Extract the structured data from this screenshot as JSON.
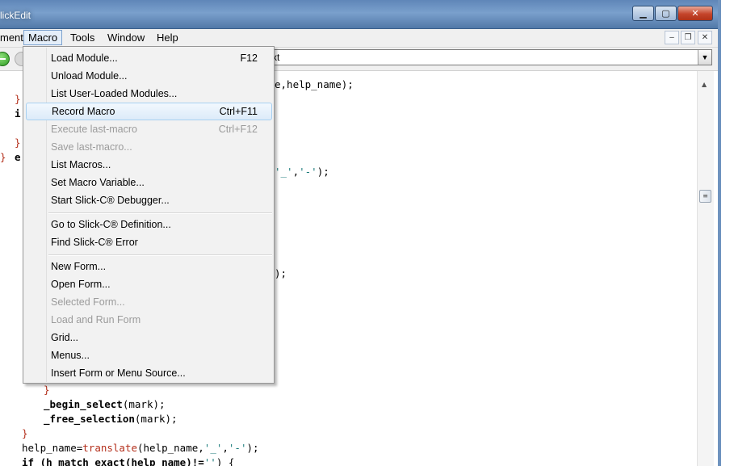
{
  "window": {
    "title": "lickEdit",
    "minimize_icon": "▁",
    "maximize_icon": "▢",
    "close_icon": "✕"
  },
  "menubar": {
    "items": [
      "ment",
      "Macro",
      "Tools",
      "Window",
      "Help"
    ],
    "mdi_minimize": "–",
    "mdi_restore": "❐",
    "mdi_close": "✕"
  },
  "toolbar": {
    "combo_value": "xt",
    "combo_arrow": "▼"
  },
  "editor": {
    "lines": [
      {
        "indent": "",
        "segs": [
          [
            "",
            "e,help_name);"
          ]
        ]
      },
      {
        "indent": "  ",
        "segs": [
          [
            "red",
            "}"
          ]
        ]
      },
      {
        "indent": "  ",
        "segs": [
          [
            "kw",
            "i"
          ]
        ]
      },
      {
        "indent": "  ",
        "segs": [
          [
            "",
            ""
          ]
        ]
      },
      {
        "indent": "  ",
        "segs": [
          [
            "red",
            "}"
          ]
        ]
      },
      {
        "indent": "",
        "segs": [
          [
            "red",
            "}"
          ],
          [
            "",
            " "
          ],
          [
            "kw",
            "e"
          ]
        ]
      }
    ],
    "frag_help": "e,help_name);",
    "frag_replace_a": "'_'",
    "frag_replace_sep": ",",
    "frag_replace_b": "'-'",
    "frag_replace_end": ");",
    "frag_close": ");",
    "bottom_brace": "}",
    "begin_select": "_begin_select",
    "begin_select_args": "(mark);",
    "free_selection": "_free_selection",
    "free_selection_args": "(mark);",
    "close_brace": "}",
    "help_name_assign": "help_name=",
    "translate_fn": "translate",
    "translate_args_a": "(help_name,",
    "translate_str1": "'_'",
    "translate_comma": ",",
    "translate_str2": "'-'",
    "translate_end": ");",
    "if_kw": "if",
    "if_rest": " (h_match_exact(help_name)!=",
    "if_str": "''",
    "if_end": ") {",
    "left_frag_1": "}",
    "left_frag_2": "i",
    "left_frag_3": "}",
    "left_frag_4": "}",
    "left_frag_5": "e"
  },
  "macro_menu": {
    "items": [
      {
        "label": "Load Module...",
        "shortcut": "F12",
        "disabled": false
      },
      {
        "label": "Unload Module...",
        "shortcut": "",
        "disabled": false
      },
      {
        "label": "List User-Loaded Modules...",
        "shortcut": "",
        "disabled": false
      },
      {
        "label": "Record Macro",
        "shortcut": "Ctrl+F11",
        "disabled": false,
        "highlighted": true
      },
      {
        "label": "Execute last-macro",
        "shortcut": "Ctrl+F12",
        "disabled": true
      },
      {
        "label": "Save last-macro...",
        "shortcut": "",
        "disabled": true
      },
      {
        "label": "List Macros...",
        "shortcut": "",
        "disabled": false
      },
      {
        "label": "Set Macro Variable...",
        "shortcut": "",
        "disabled": false
      },
      {
        "label": "Start Slick-C® Debugger...",
        "shortcut": "",
        "disabled": false
      },
      {
        "label": "Go to Slick-C® Definition...",
        "shortcut": "",
        "disabled": false
      },
      {
        "label": "Find Slick-C® Error",
        "shortcut": "",
        "disabled": false
      },
      {
        "label": "New Form...",
        "shortcut": "",
        "disabled": false
      },
      {
        "label": "Open Form...",
        "shortcut": "",
        "disabled": false
      },
      {
        "label": "Selected Form...",
        "shortcut": "",
        "disabled": true
      },
      {
        "label": "Load and Run Form",
        "shortcut": "",
        "disabled": true
      },
      {
        "label": "Grid...",
        "shortcut": "",
        "disabled": false
      },
      {
        "label": "Menus...",
        "shortcut": "",
        "disabled": false
      },
      {
        "label": "Insert Form or Menu Source...",
        "shortcut": "",
        "disabled": false
      }
    ]
  },
  "scrollbar": {
    "up_arrow": "▲",
    "thumb_grip": "≡"
  }
}
